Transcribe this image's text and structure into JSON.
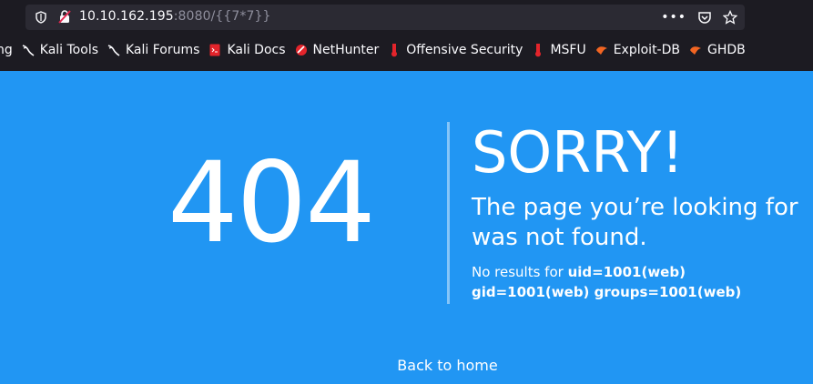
{
  "browser": {
    "url_host": "10.10.162.195",
    "url_rest": ":8080/{{7*7}}",
    "bookmarks": [
      {
        "label": "ng",
        "icon": "none"
      },
      {
        "label": "Kali Tools",
        "icon": "kali-dragon-icon"
      },
      {
        "label": "Kali Forums",
        "icon": "kali-dragon-icon"
      },
      {
        "label": "Kali Docs",
        "icon": "kali-docs-icon"
      },
      {
        "label": "NetHunter",
        "icon": "nethunter-icon"
      },
      {
        "label": "Offensive Security",
        "icon": "offsec-icon"
      },
      {
        "label": "MSFU",
        "icon": "offsec-icon"
      },
      {
        "label": "Exploit-DB",
        "icon": "exploitdb-icon"
      },
      {
        "label": "GHDB",
        "icon": "exploitdb-icon"
      }
    ]
  },
  "page": {
    "code": "404",
    "headline": "SORRY!",
    "subtitle": "The page you’re looking for was not found.",
    "detail_prefix": "No results for ",
    "detail_value": "uid=1001(web) gid=1001(web) groups=1001(web)",
    "back_link": "Back to home"
  },
  "colors": {
    "background": "#2196f3",
    "chrome": "#1c1b22",
    "urlbar": "#2b2a33"
  }
}
